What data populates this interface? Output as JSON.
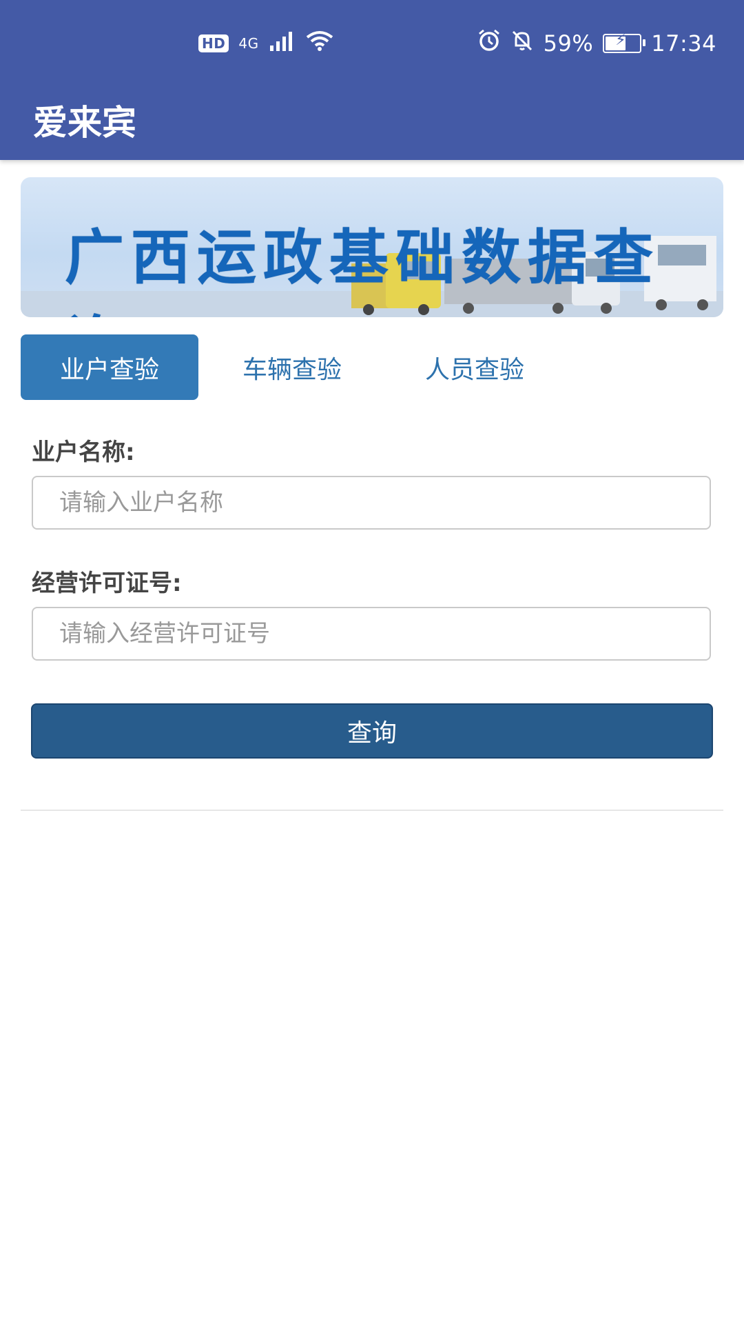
{
  "status_bar": {
    "hd": "HD",
    "network": "4G",
    "battery": "59%",
    "time": "17:34"
  },
  "app": {
    "title": "爱来宾"
  },
  "banner": {
    "title": "广西运政基础数据查询"
  },
  "tabs": [
    {
      "label": "业户查验",
      "active": true
    },
    {
      "label": "车辆查验",
      "active": false
    },
    {
      "label": "人员查验",
      "active": false
    }
  ],
  "form": {
    "name_label": "业户名称:",
    "name_placeholder": "请输入业户名称",
    "license_label": "经营许可证号:",
    "license_placeholder": "请输入经营许可证号",
    "submit_label": "查询"
  },
  "colors": {
    "appbar": "#445aa6",
    "tab_active": "#337ab7",
    "button": "#285c8c"
  }
}
